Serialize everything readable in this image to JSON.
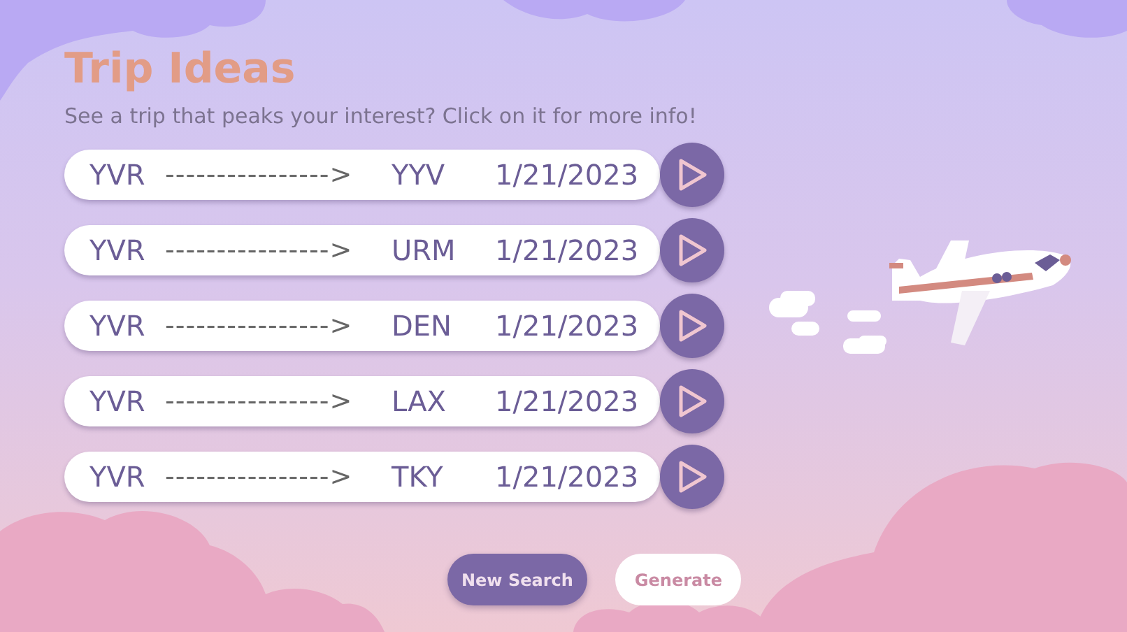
{
  "title": "Trip Ideas",
  "subtitle": "See a trip that peaks your interest? Click on it for more info!",
  "trips": [
    {
      "origin": "YVR",
      "arrow": "---------------->",
      "destination": "YYV",
      "date": "1/21/2023"
    },
    {
      "origin": "YVR",
      "arrow": "---------------->",
      "destination": "URM",
      "date": "1/21/2023"
    },
    {
      "origin": "YVR",
      "arrow": "---------------->",
      "destination": "DEN",
      "date": "1/21/2023"
    },
    {
      "origin": "YVR",
      "arrow": "---------------->",
      "destination": "LAX",
      "date": "1/21/2023"
    },
    {
      "origin": "YVR",
      "arrow": "---------------->",
      "destination": "TKY",
      "date": "1/21/2023"
    }
  ],
  "buttons": [
    {
      "label": "New Search",
      "disabled": false
    },
    {
      "label": "Generate",
      "disabled": true
    }
  ]
}
